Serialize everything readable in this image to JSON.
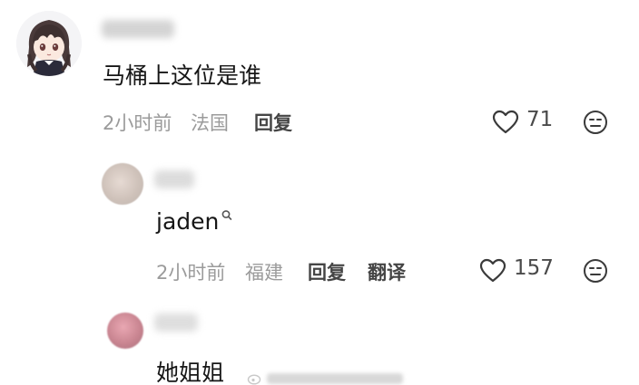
{
  "comments": [
    {
      "content": "马桶上这位是谁",
      "time": "2小时前",
      "location": "法国",
      "reply_label": "回复",
      "likes": "71"
    },
    {
      "content": "jaden",
      "time": "2小时前",
      "location": "福建",
      "reply_label": "回复",
      "translate_label": "翻译",
      "likes": "157"
    },
    {
      "content": "她姐姐"
    }
  ],
  "icons": {
    "like": "heart-outline-icon",
    "reaction": "neutral-face-icon",
    "search": "search-icon"
  },
  "colors": {
    "text_primary": "#161616",
    "text_meta": "#9b9b9b",
    "text_action": "#454545"
  }
}
